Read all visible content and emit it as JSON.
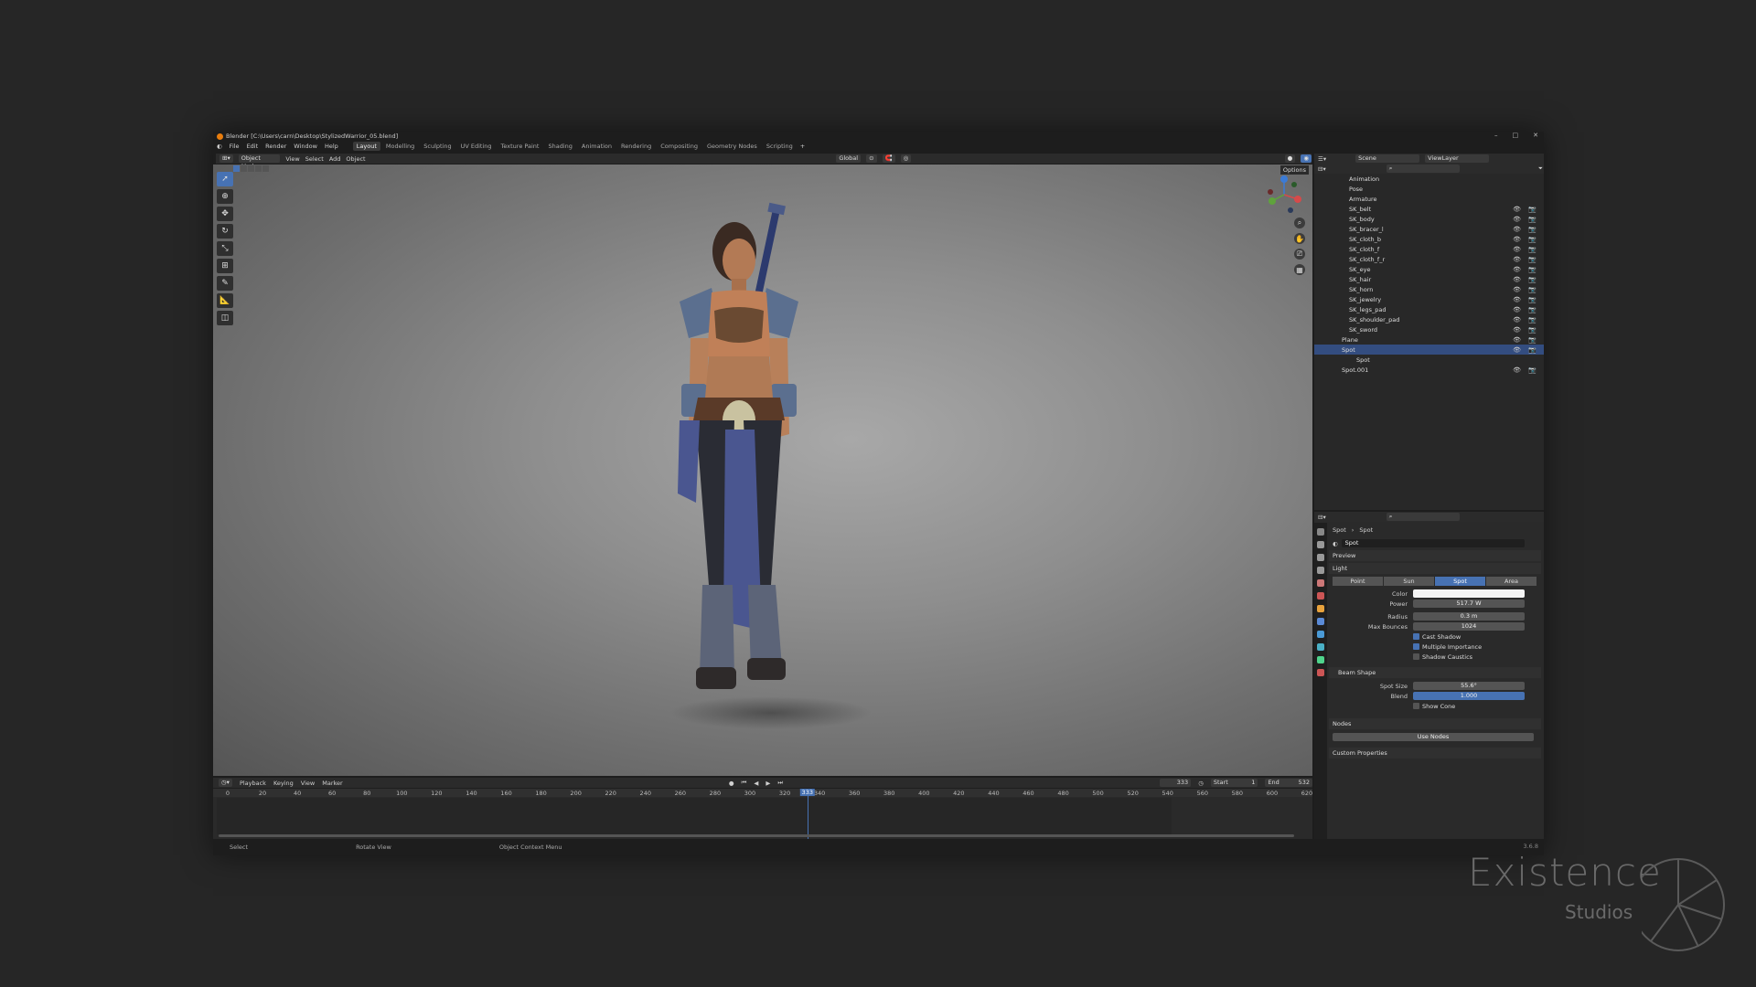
{
  "window": {
    "title": "Blender [C:\\Users\\carn\\Desktop\\StylizedWarrior_05.blend]"
  },
  "menu": [
    "File",
    "Edit",
    "Render",
    "Window",
    "Help"
  ],
  "workspaces": [
    {
      "label": "Layout",
      "active": true
    },
    {
      "label": "Modelling"
    },
    {
      "label": "Sculpting"
    },
    {
      "label": "UV Editing"
    },
    {
      "label": "Texture Paint"
    },
    {
      "label": "Shading"
    },
    {
      "label": "Animation"
    },
    {
      "label": "Rendering"
    },
    {
      "label": "Compositing"
    },
    {
      "label": "Geometry Nodes"
    },
    {
      "label": "Scripting"
    }
  ],
  "viewport": {
    "mode": "Object Mode",
    "menus": [
      "View",
      "Select",
      "Add",
      "Object"
    ],
    "orientation": "Global",
    "options": "Options"
  },
  "timeline": {
    "menus": [
      "Playback",
      "Keying",
      "View",
      "Marker"
    ],
    "current_frame": "333",
    "start_label": "Start",
    "start": "1",
    "end_label": "End",
    "end": "532",
    "ticks": [
      "0",
      "20",
      "40",
      "60",
      "80",
      "100",
      "120",
      "140",
      "160",
      "180",
      "200",
      "220",
      "240",
      "260",
      "280",
      "300",
      "320",
      "340",
      "360",
      "380",
      "400",
      "420",
      "440",
      "460",
      "480",
      "500",
      "520",
      "540",
      "560",
      "580",
      "600",
      "620"
    ]
  },
  "status": {
    "select": "Select",
    "rotate": "Rotate View",
    "context": "Object Context Menu",
    "version": "3.6.8"
  },
  "outliner": {
    "scene": "Scene",
    "viewlayer": "ViewLayer",
    "rows": [
      {
        "label": "Animation",
        "indent": 2
      },
      {
        "label": "Pose",
        "indent": 2
      },
      {
        "label": "Armature",
        "indent": 2
      },
      {
        "label": "SK_belt",
        "indent": 2,
        "mesh": true
      },
      {
        "label": "SK_body",
        "indent": 2,
        "mesh": true
      },
      {
        "label": "SK_bracer_l",
        "indent": 2,
        "mesh": true
      },
      {
        "label": "SK_cloth_b",
        "indent": 2,
        "mesh": true
      },
      {
        "label": "SK_cloth_f",
        "indent": 2,
        "mesh": true
      },
      {
        "label": "SK_cloth_f_r",
        "indent": 2,
        "mesh": true
      },
      {
        "label": "SK_eye",
        "indent": 2,
        "mesh": true
      },
      {
        "label": "SK_hair",
        "indent": 2,
        "mesh": true
      },
      {
        "label": "SK_horn",
        "indent": 2,
        "mesh": true
      },
      {
        "label": "SK_jewelry",
        "indent": 2,
        "mesh": true
      },
      {
        "label": "SK_legs_pad",
        "indent": 2,
        "mesh": true
      },
      {
        "label": "SK_shoulder_pad",
        "indent": 2,
        "mesh": true
      },
      {
        "label": "SK_sword",
        "indent": 2,
        "mesh": true
      },
      {
        "label": "Plane",
        "indent": 1
      },
      {
        "label": "Spot",
        "indent": 1,
        "selected": true
      },
      {
        "label": "Spot",
        "indent": 3
      },
      {
        "label": "Spot.001",
        "indent": 1
      }
    ]
  },
  "properties": {
    "breadcrumb": [
      "Spot",
      "Spot"
    ],
    "datablock": "Spot",
    "sections": {
      "preview": "Preview",
      "light": "Light",
      "beam": "Beam Shape",
      "nodes": "Nodes",
      "custom": "Custom Properties"
    },
    "light_types": [
      {
        "label": "Point"
      },
      {
        "label": "Sun"
      },
      {
        "label": "Spot",
        "active": true
      },
      {
        "label": "Area"
      }
    ],
    "color_label": "Color",
    "power_label": "Power",
    "power": "517.7 W",
    "radius_label": "Radius",
    "radius": "0.3 m",
    "bounces_label": "Max Bounces",
    "bounces": "1024",
    "cast_shadow": "Cast Shadow",
    "multiple_importance": "Multiple Importance",
    "shadow_caustics": "Shadow Caustics",
    "spot_size_label": "Spot Size",
    "spot_size": "55.6°",
    "blend_label": "Blend",
    "blend": "1.000",
    "show_cone": "Show Cone",
    "use_nodes": "Use Nodes"
  },
  "brand": {
    "line1": "Existence",
    "line2": "Studios"
  },
  "colors": {
    "accent": "#4772b3",
    "bg": "#262626"
  }
}
